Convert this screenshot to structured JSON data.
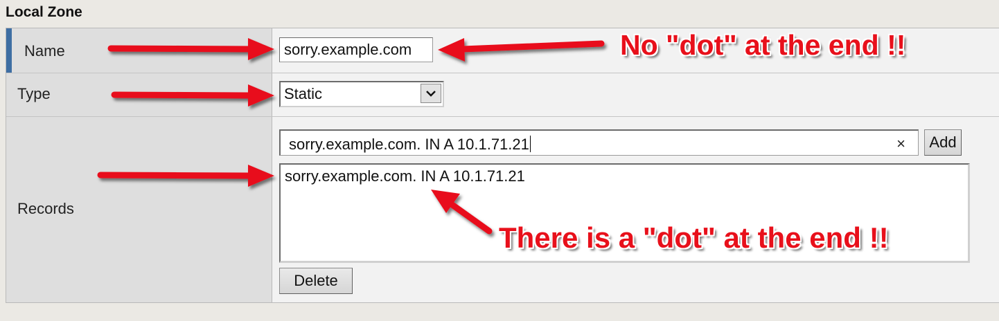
{
  "section": {
    "title": "Local Zone"
  },
  "form": {
    "name": {
      "label": "Name",
      "value": "sorry.example.com"
    },
    "type": {
      "label": "Type",
      "selected": "Static"
    },
    "records": {
      "label": "Records",
      "input_value": "sorry.example.com. IN A 10.1.71.21",
      "clear_icon": "×",
      "add_label": "Add",
      "items": [
        "sorry.example.com. IN A 10.1.71.21"
      ],
      "delete_label": "Delete"
    }
  },
  "annotations": {
    "top": "No \"dot\" at the end !!",
    "bottom": "There is a \"dot\" at the end !!",
    "color": "#e8101b"
  }
}
